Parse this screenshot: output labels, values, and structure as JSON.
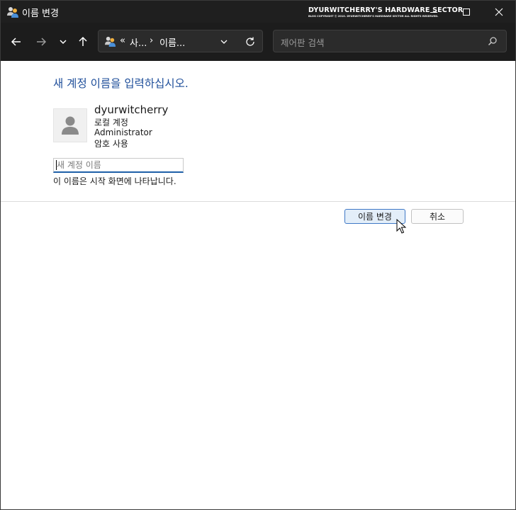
{
  "titlebar": {
    "title": "이름 변경",
    "watermark_line1": "DYURWITCHERRY'S HARDWARE SECTOR",
    "watermark_line2": "BLOG COPYRIGHT ⓒ 2010. DYURWITCHERRY'S HARDWARE SECTOR ALL RIGHTS RESERVED."
  },
  "address": {
    "crumb1": "사...",
    "crumb2": "이름...",
    "overflow": "«",
    "separator": "›"
  },
  "search": {
    "placeholder": "제어판 검색"
  },
  "content": {
    "heading": "새 계정 이름을 입력하십시오.",
    "user_name": "dyurwitcherry",
    "account_type": "로컬 계정",
    "role": "Administrator",
    "password_status": "암호 사용",
    "input_placeholder": "새 계정 이름",
    "input_value": "",
    "hint": "이 이름은 시작 화면에 나타납니다."
  },
  "buttons": {
    "rename": "이름 변경",
    "cancel": "취소"
  },
  "colors": {
    "titlebar_bg": "#1f1f1f",
    "navbar_bg": "#1c1c1c",
    "heading": "#1e4e9a",
    "accent": "#3f78c6"
  }
}
